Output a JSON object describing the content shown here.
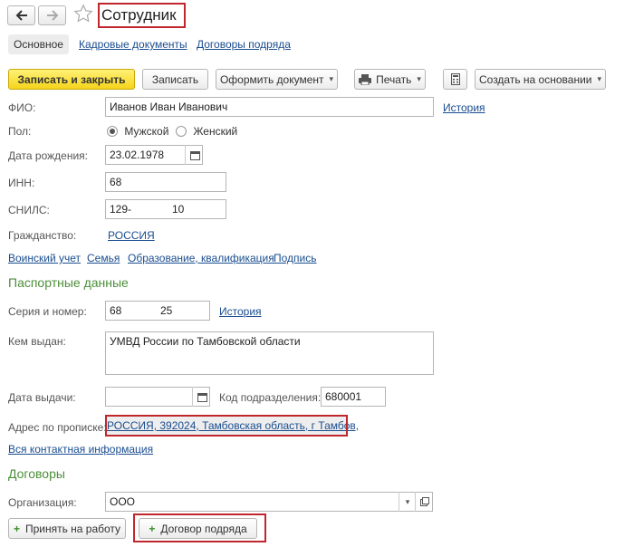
{
  "header": {
    "back_icon": "arrow-left-icon",
    "forward_icon": "arrow-right-icon",
    "star_icon": "star-outline-icon",
    "title": "Сотрудник"
  },
  "tabs": [
    {
      "label": "Основное",
      "active": true
    },
    {
      "label": "Кадровые документы",
      "active": false
    },
    {
      "label": "Договоры подряда",
      "active": false
    }
  ],
  "toolbar": {
    "save_close": "Записать и закрыть",
    "save": "Записать",
    "make_doc": "Оформить документ",
    "print": "Печать",
    "create_based": "Создать на основании"
  },
  "form": {
    "fio_label": "ФИО:",
    "fio_value": "Иванов Иван Иванович",
    "history_link": "История",
    "gender_label": "Пол:",
    "gender_male": "Мужской",
    "gender_female": "Женский",
    "birth_label": "Дата рождения:",
    "birth_value": "23.02.1978",
    "inn_label": "ИНН:",
    "inn_value": "68",
    "snils_label": "СНИЛС:",
    "snils_value_a": "129-",
    "snils_value_b": "10",
    "citizenship_label": "Гражданство:",
    "citizenship_value": "РОССИЯ"
  },
  "links": [
    "Воинский учет",
    "Семья",
    "Образование, квалификация",
    "Подпись"
  ],
  "passport": {
    "section_title": "Паспортные данные",
    "series_label": "Серия и номер:",
    "series_a": "68",
    "series_b": "25",
    "history_link": "История",
    "issued_label": "Кем выдан:",
    "issued_value": "УМВД России по Тамбовской области",
    "issue_date_label": "Дата выдачи:",
    "issue_date_value": "",
    "dept_code_label": "Код подразделения:",
    "dept_code_value": "680001",
    "address_label": "Адрес по прописке:",
    "address_value": "РОССИЯ, 392024, Тамбовская область, г Тамбов,",
    "contact_link": "Вся контактная информация"
  },
  "contracts": {
    "section_title": "Договоры",
    "org_label": "Организация:",
    "org_value": "ООО",
    "hire_button": "Принять на работу",
    "contract_button": "Договор подряда"
  },
  "colors": {
    "highlight_box": "#c0272d",
    "primary_button": "#f5d41b",
    "section_title": "#4c8f3a",
    "link": "#1a4d8f"
  }
}
